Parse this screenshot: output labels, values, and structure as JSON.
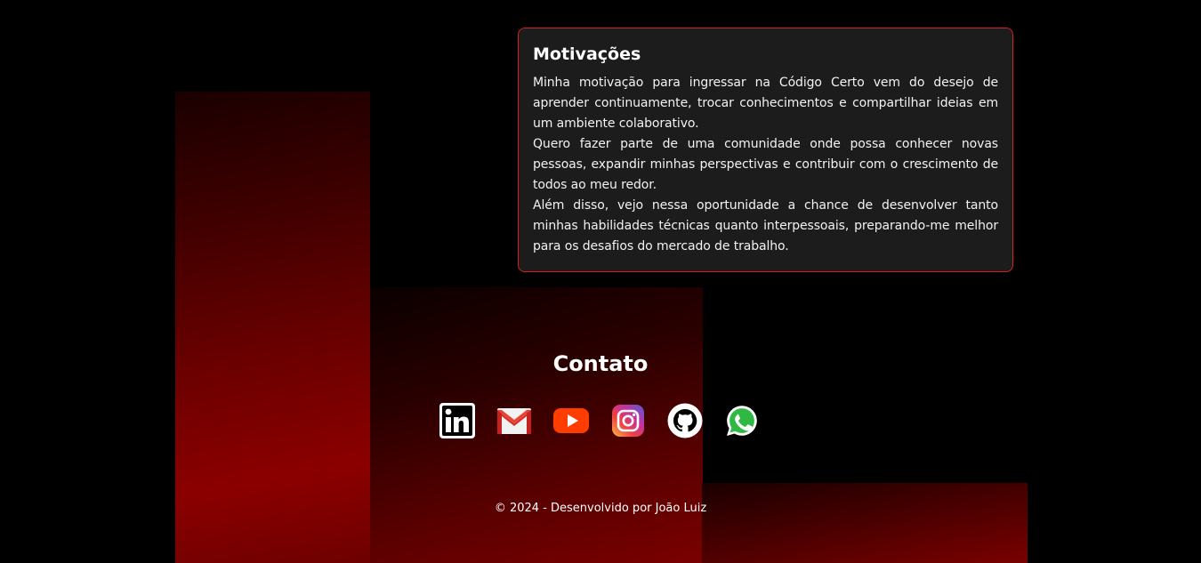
{
  "motivations": {
    "title": "Motivações",
    "paragraphs": [
      "Minha motivação para ingressar na Código Certo vem do desejo de aprender continuamente, trocar conhecimentos e compartilhar ideias em um ambiente colaborativo.",
      "Quero fazer parte de uma comunidade onde possa conhecer novas pessoas, expandir minhas perspectivas e contribuir com o crescimento de todos ao meu redor.",
      "Além disso, vejo nessa oportunidade a chance de desenvolver tanto minhas habilidades técnicas quanto interpessoais, preparando-me melhor para os desafios do mercado de trabalho."
    ]
  },
  "contact": {
    "title": "Contato",
    "links": [
      {
        "icon": "linkedin-icon"
      },
      {
        "icon": "gmail-icon"
      },
      {
        "icon": "youtube-icon"
      },
      {
        "icon": "instagram-icon"
      },
      {
        "icon": "github-icon"
      },
      {
        "icon": "whatsapp-icon"
      }
    ]
  },
  "footer": {
    "text": "© 2024 - Desenvolvido por João Luiz"
  },
  "colors": {
    "background": "#000000",
    "card_background": "#1c1c1c",
    "card_border": "#d32020",
    "accent_red": "#8b0000"
  }
}
